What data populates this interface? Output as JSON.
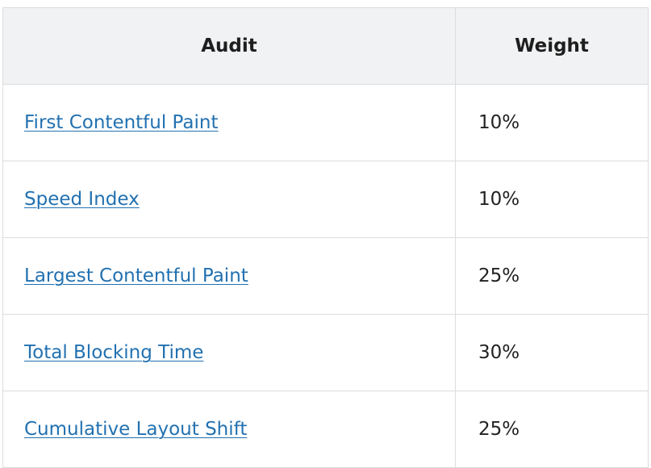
{
  "table": {
    "headers": {
      "audit": "Audit",
      "weight": "Weight"
    },
    "rows": [
      {
        "audit": "First Contentful Paint",
        "weight": "10%"
      },
      {
        "audit": "Speed Index",
        "weight": "10%"
      },
      {
        "audit": "Largest Contentful Paint",
        "weight": "25%"
      },
      {
        "audit": "Total Blocking Time",
        "weight": "30%"
      },
      {
        "audit": "Cumulative Layout Shift",
        "weight": "25%"
      }
    ]
  },
  "colors": {
    "link": "#2271b1",
    "header_bg": "#f1f2f3",
    "border": "#dcdcde"
  }
}
